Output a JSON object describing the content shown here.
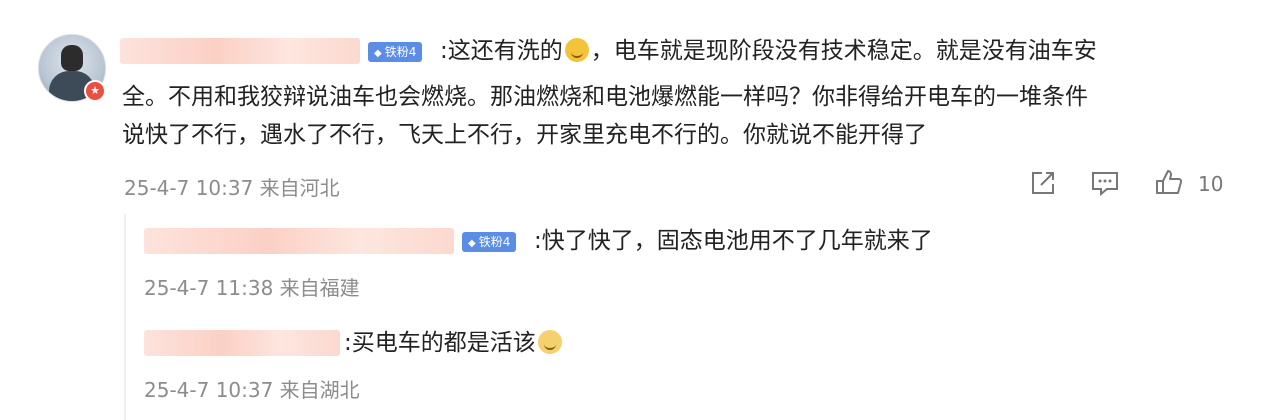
{
  "comment": {
    "badge": "铁粉4",
    "text_line1": ":这还有洗的",
    "text_line1_rest": "，电车就是现阶段没有技术稳定。就是没有油车安",
    "text_line2": "全。不用和我狡辩说油车也会燃烧。那油燃烧和电池爆燃能一样吗？你非得给开电车的一堆条件",
    "text_line3": "说快了不行，遇水了不行，飞天上不行，开家里充电不行的。你就说不能开得了",
    "meta": "25-4-7 10:37 来自河北",
    "like_count": "10"
  },
  "replies": [
    {
      "badge": "铁粉4",
      "text": ":快了快了，固态电池用不了几年就来了",
      "meta": "25-4-7 11:38 来自福建"
    },
    {
      "text": ":买电车的都是活该",
      "meta": "25-4-7 10:37 来自湖北"
    }
  ],
  "icons": {
    "share": "share-icon",
    "comment": "comment-icon",
    "like": "like-icon"
  }
}
